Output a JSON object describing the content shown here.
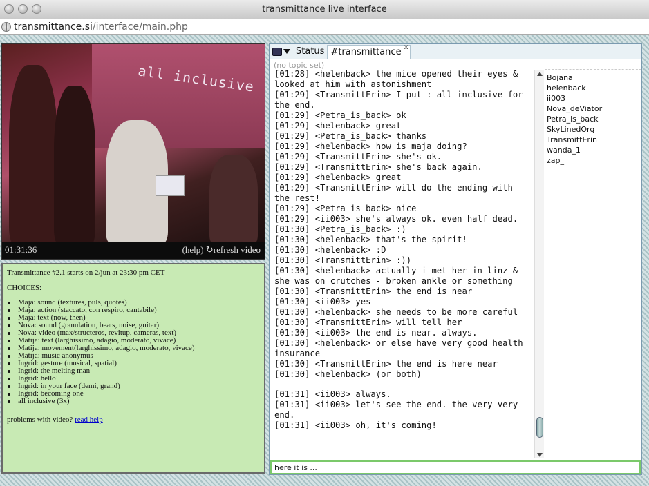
{
  "window": {
    "title": "transmittance live interface"
  },
  "address": {
    "host": "transmittance.si",
    "path": "/interface/main.php"
  },
  "video": {
    "caption": "all inclusive",
    "time": "01:31:36",
    "help_label": "(help)",
    "refresh_label": "↻refresh video"
  },
  "info": {
    "headline": "Transmittance #2.1 starts on 2/jun at 23:30 pm CET",
    "choices_heading": "CHOICES:",
    "choices": [
      "Maja: sound (textures, puls, quotes)",
      "Maja: action (staccato, con respiro, cantabile)",
      "Maja: text (now, then)",
      "Nova: sound (granulation, beats, noise, guitar)",
      "Nova: video (max/structeros, revitup, cameras, text)",
      "Matija: text (larghissimo, adagio, moderato, vivace)",
      "Matija: movement(larghissimo, adagio, moderato, vivace)",
      "Matija: music anonymus",
      "Ingrid: gesture (musical, spatial)",
      "Ingrid: the melting man",
      "Ingrid: hello!",
      "Ingrid: in your face (demi, grand)",
      "Ingrid: becoming one",
      "all inclusive (3x)"
    ],
    "problems_text": "problems with video? ",
    "help_link": "read help"
  },
  "chat": {
    "tabs": [
      {
        "label": "Status",
        "active": false
      },
      {
        "label": "#transmittance",
        "active": true
      }
    ],
    "close_glyph": "x",
    "topic": "(no topic set)",
    "log_before": [
      "[01:28] <helenback> the mice opened their eyes & looked at him with astonishment",
      "[01:29] <TransmittErin> I put : all inclusive for the end.",
      "[01:29] <Petra_is_back> ok",
      "[01:29] <helenback> great",
      "[01:29] <Petra_is_back> thanks",
      "[01:29] <helenback> how is maja doing?",
      "[01:29] <TransmittErin> she's ok.",
      "[01:29] <TransmittErin> she's back again.",
      "[01:29] <helenback> great",
      "[01:29] <TransmittErin> will do the ending with the rest!",
      "[01:29] <Petra_is_back> nice",
      "[01:29] <ii003> she's always ok. even half dead.",
      "[01:30] <Petra_is_back> :)",
      "[01:30] <helenback> that's the spirit!",
      "[01:30] <helenback> :D",
      "[01:30] <TransmittErin> :))",
      "[01:30] <helenback> actually i met her in linz & she was on crutches - broken ankle or something",
      "[01:30] <TransmittErin> the end is near",
      "[01:30] <ii003> yes",
      "[01:30] <helenback> she needs to be more careful",
      "[01:30] <TransmittErin> will tell her",
      "[01:30] <ii003> the end is near. always.",
      "[01:30] <helenback> or else have very good health insurance",
      "[01:30] <TransmittErin> the end is here near",
      "[01:30] <helenback> (or both)"
    ],
    "log_after": [
      "[01:31] <ii003> always.",
      "[01:31] <ii003> let's see the end. the very very end.",
      "[01:31] <ii003> oh, it's coming!"
    ],
    "users": [
      "Bojana",
      "helenback",
      "ii003",
      "Nova_deViator",
      "Petra_is_back",
      "SkyLinedOrg",
      "TransmittErin",
      "wanda_1",
      "zap_"
    ],
    "input_value": "here it is ..."
  }
}
